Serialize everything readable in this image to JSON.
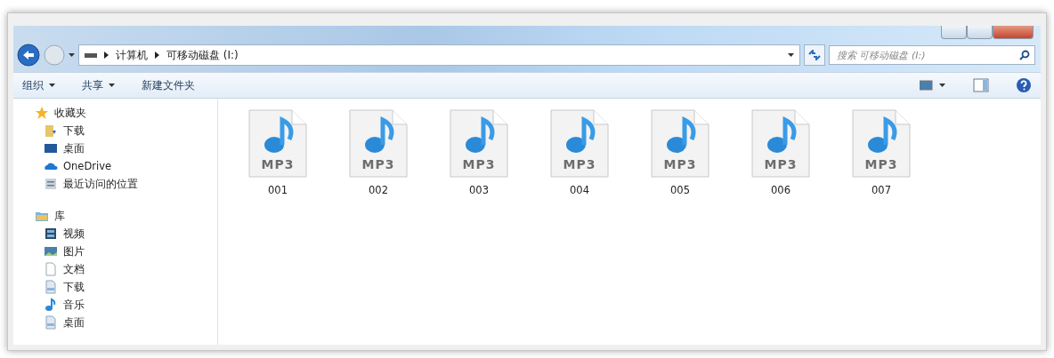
{
  "address_bar": {
    "path": [
      "计算机",
      "可移动磁盘 (I:)"
    ]
  },
  "search": {
    "placeholder": "搜索 可移动磁盘 (I:)"
  },
  "toolbar": {
    "items": [
      {
        "label": "组织",
        "dropdown": true
      },
      {
        "label": "共享",
        "dropdown": true
      },
      {
        "label": "新建文件夹",
        "dropdown": false
      }
    ]
  },
  "sidebar": {
    "groups": [
      {
        "label": "收藏夹",
        "kind": "star",
        "children": [
          {
            "label": "下载",
            "kind": "download"
          },
          {
            "label": "桌面",
            "kind": "desktop"
          },
          {
            "label": "OneDrive",
            "kind": "cloud"
          },
          {
            "label": "最近访问的位置",
            "kind": "recent"
          }
        ]
      },
      {
        "label": "库",
        "kind": "library",
        "children": [
          {
            "label": "视频",
            "kind": "video"
          },
          {
            "label": "图片",
            "kind": "picture"
          },
          {
            "label": "文档",
            "kind": "document"
          },
          {
            "label": "下载",
            "kind": "doc"
          },
          {
            "label": "音乐",
            "kind": "music"
          },
          {
            "label": "桌面",
            "kind": "doc"
          }
        ]
      }
    ]
  },
  "files": [
    {
      "name": "001",
      "badge": "MP3"
    },
    {
      "name": "002",
      "badge": "MP3"
    },
    {
      "name": "003",
      "badge": "MP3"
    },
    {
      "name": "004",
      "badge": "MP3"
    },
    {
      "name": "005",
      "badge": "MP3"
    },
    {
      "name": "006",
      "badge": "MP3"
    },
    {
      "name": "007",
      "badge": "MP3"
    }
  ]
}
